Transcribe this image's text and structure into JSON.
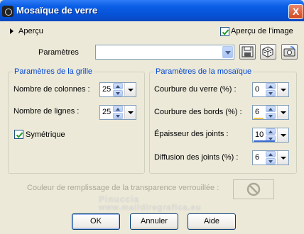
{
  "window": {
    "title": "Mosaïque de verre",
    "close_label": "X"
  },
  "apercu": {
    "label": "Aperçu",
    "preview_label": "Aperçu de l'image",
    "preview_checked": true
  },
  "presets": {
    "label": "Paramètres",
    "value": ""
  },
  "grid": {
    "title": "Paramètres de la grille",
    "columns_label": "Nombre de colonnes :",
    "columns_value": "25",
    "rows_label": "Nombre de lignes :",
    "rows_value": "25",
    "symmetric_label": "Symétrique",
    "symmetric_checked": true
  },
  "mosaic": {
    "title": "Paramètres de la mosaïque",
    "glass_curve_label": "Courbure du verre (%) :",
    "glass_curve_value": "0",
    "edge_curve_label": "Courbure des bords (%) :",
    "edge_curve_value": "6",
    "grout_width_label": "Épaisseur des joints :",
    "grout_width_value": "10",
    "grout_diffuse_label": "Diffusion des joints (%) :",
    "grout_diffuse_value": "6"
  },
  "transparency": {
    "label": "Couleur de remplissage de la transparence verrouillée :"
  },
  "buttons": {
    "ok": "OK",
    "cancel": "Annuler",
    "help": "Aide"
  },
  "watermark": {
    "line1": "Pinuccia",
    "line2": "www.maildiregrafica.eu"
  }
}
